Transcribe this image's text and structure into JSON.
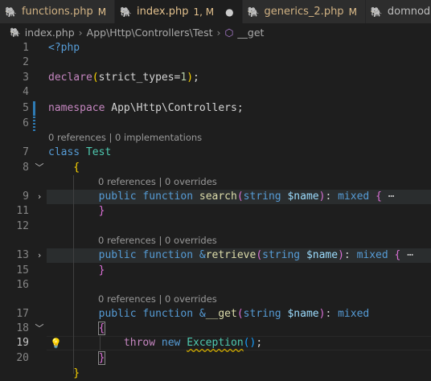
{
  "tabs": [
    {
      "name": "functions.php",
      "badge": "M",
      "active": false
    },
    {
      "name": "index.php",
      "badge": "1, M",
      "active": true
    },
    {
      "name": "generics_2.php",
      "badge": "M",
      "active": false
    },
    {
      "name": "domnode",
      "badge": "",
      "active": false
    }
  ],
  "breadcrumb": {
    "file": "index.php",
    "namespace": "App\\Http\\Controllers\\Test",
    "symbol": "__get"
  },
  "code_lens": {
    "class_refs": "0 references | 0 implementations",
    "method_refs": "0 references | 0 overrides"
  },
  "code": {
    "l1": "<?php",
    "l3_kw": "declare",
    "l3_arg": "strict_types",
    "l3_val": "1",
    "l5_kw": "namespace",
    "l5_ns": "App\\Http\\Controllers",
    "l7_kw": "class",
    "l7_name": "Test",
    "public": "public",
    "function": "function",
    "search_fn": "search",
    "retrieve_fn": "retrieve",
    "get_fn": "__get",
    "type_string": "string",
    "param": "$name",
    "ret_type": "mixed",
    "ellipsis": "⋯",
    "throw": "throw",
    "new": "new",
    "exception": "Exception"
  },
  "line_numbers": [
    "1",
    "3",
    "4",
    "5",
    "6",
    "7",
    "8",
    "9",
    "11",
    "12",
    "13",
    "15",
    "16",
    "17",
    "18",
    "19",
    "20"
  ]
}
